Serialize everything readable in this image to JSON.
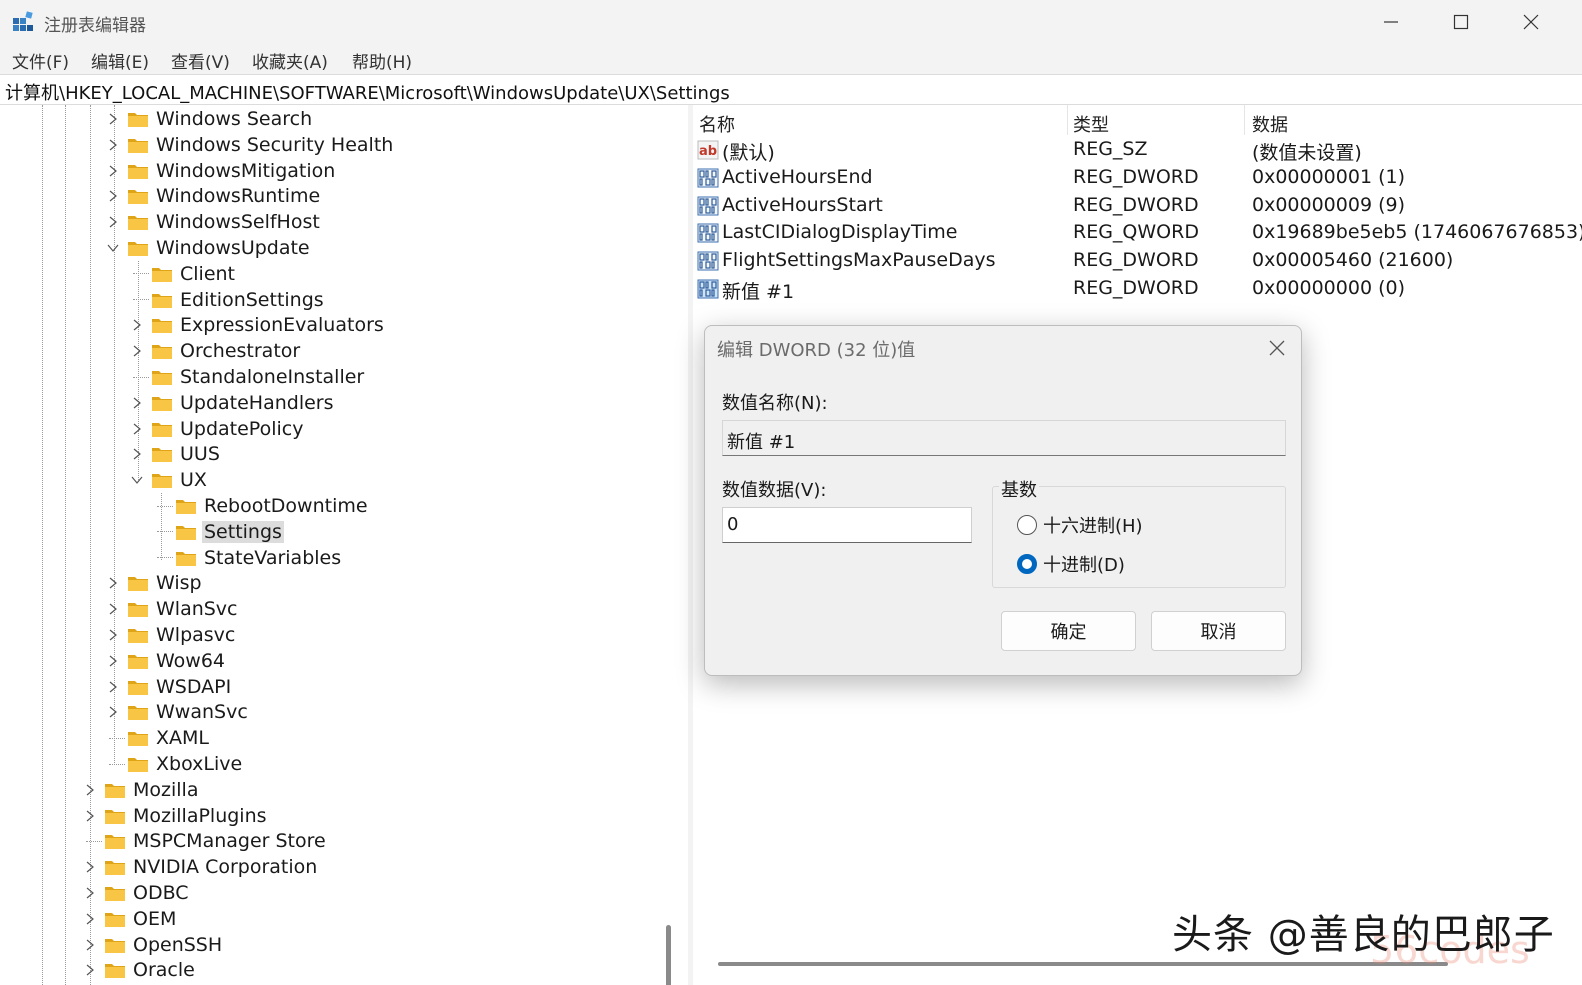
{
  "window": {
    "title": "注册表编辑器",
    "minimize": "minimize",
    "maximize": "maximize",
    "close": "close"
  },
  "menu": [
    "文件(F)",
    "编辑(E)",
    "查看(V)",
    "收藏夹(A)",
    "帮助(H)"
  ],
  "address": "计算机\\HKEY_LOCAL_MACHINE\\SOFTWARE\\Microsoft\\WindowsUpdate\\UX\\Settings",
  "tree": [
    {
      "label": "Windows Search",
      "depth": 2,
      "expander": "collapsed"
    },
    {
      "label": "Windows Security Health",
      "depth": 2,
      "expander": "collapsed"
    },
    {
      "label": "WindowsMitigation",
      "depth": 2,
      "expander": "collapsed"
    },
    {
      "label": "WindowsRuntime",
      "depth": 2,
      "expander": "collapsed"
    },
    {
      "label": "WindowsSelfHost",
      "depth": 2,
      "expander": "collapsed"
    },
    {
      "label": "WindowsUpdate",
      "depth": 2,
      "expander": "expanded"
    },
    {
      "label": "Client",
      "depth": 3,
      "expander": "none"
    },
    {
      "label": "EditionSettings",
      "depth": 3,
      "expander": "none"
    },
    {
      "label": "ExpressionEvaluators",
      "depth": 3,
      "expander": "collapsed"
    },
    {
      "label": "Orchestrator",
      "depth": 3,
      "expander": "collapsed"
    },
    {
      "label": "StandaloneInstaller",
      "depth": 3,
      "expander": "none"
    },
    {
      "label": "UpdateHandlers",
      "depth": 3,
      "expander": "collapsed"
    },
    {
      "label": "UpdatePolicy",
      "depth": 3,
      "expander": "collapsed"
    },
    {
      "label": "UUS",
      "depth": 3,
      "expander": "collapsed"
    },
    {
      "label": "UX",
      "depth": 3,
      "expander": "expanded"
    },
    {
      "label": "RebootDowntime",
      "depth": 4,
      "expander": "none"
    },
    {
      "label": "Settings",
      "depth": 4,
      "expander": "none",
      "selected": true
    },
    {
      "label": "StateVariables",
      "depth": 4,
      "expander": "none"
    },
    {
      "label": "Wisp",
      "depth": 2,
      "expander": "collapsed"
    },
    {
      "label": "WlanSvc",
      "depth": 2,
      "expander": "collapsed"
    },
    {
      "label": "Wlpasvc",
      "depth": 2,
      "expander": "collapsed"
    },
    {
      "label": "Wow64",
      "depth": 2,
      "expander": "collapsed"
    },
    {
      "label": "WSDAPI",
      "depth": 2,
      "expander": "collapsed"
    },
    {
      "label": "WwanSvc",
      "depth": 2,
      "expander": "collapsed"
    },
    {
      "label": "XAML",
      "depth": 2,
      "expander": "none"
    },
    {
      "label": "XboxLive",
      "depth": 2,
      "expander": "none"
    },
    {
      "label": "Mozilla",
      "depth": 1,
      "expander": "collapsed"
    },
    {
      "label": "MozillaPlugins",
      "depth": 1,
      "expander": "collapsed"
    },
    {
      "label": "MSPCManager Store",
      "depth": 1,
      "expander": "none"
    },
    {
      "label": "NVIDIA Corporation",
      "depth": 1,
      "expander": "collapsed"
    },
    {
      "label": "ODBC",
      "depth": 1,
      "expander": "collapsed"
    },
    {
      "label": "OEM",
      "depth": 1,
      "expander": "collapsed"
    },
    {
      "label": "OpenSSH",
      "depth": 1,
      "expander": "collapsed"
    },
    {
      "label": "Oracle",
      "depth": 1,
      "expander": "collapsed"
    }
  ],
  "values": {
    "headers": {
      "name": "名称",
      "type": "类型",
      "data": "数据"
    },
    "rows": [
      {
        "icon": "string-value-icon",
        "name": "(默认)",
        "type": "REG_SZ",
        "data": "(数值未设置)"
      },
      {
        "icon": "binary-value-icon",
        "name": "ActiveHoursEnd",
        "type": "REG_DWORD",
        "data": "0x00000001 (1)"
      },
      {
        "icon": "binary-value-icon",
        "name": "ActiveHoursStart",
        "type": "REG_DWORD",
        "data": "0x00000009 (9)"
      },
      {
        "icon": "binary-value-icon",
        "name": "LastCIDialogDisplayTime",
        "type": "REG_QWORD",
        "data": "0x19689be5eb5 (1746067676853)"
      },
      {
        "icon": "binary-value-icon",
        "name": "FlightSettingsMaxPauseDays",
        "type": "REG_DWORD",
        "data": "0x00005460 (21600)"
      },
      {
        "icon": "binary-value-icon",
        "name": "新值 #1",
        "type": "REG_DWORD",
        "data": "0x00000000 (0)",
        "selected": true
      }
    ]
  },
  "dialog": {
    "title": "编辑 DWORD (32 位)值",
    "name_label": "数值名称(N):",
    "name_value": "新值 #1",
    "data_label": "数值数据(V):",
    "data_value": "0",
    "radix_label": "基数",
    "radix_options": [
      {
        "label": "十六进制(H)",
        "selected": false
      },
      {
        "label": "十进制(D)",
        "selected": true
      }
    ],
    "ok_label": "确定",
    "cancel_label": "取消"
  },
  "watermark": "头条 @善良的巴郎子",
  "watermark_ghost": "56codes",
  "colors": {
    "accent": "#0067c0",
    "folder": "#f8c644",
    "folder_dark": "#e0a418"
  }
}
